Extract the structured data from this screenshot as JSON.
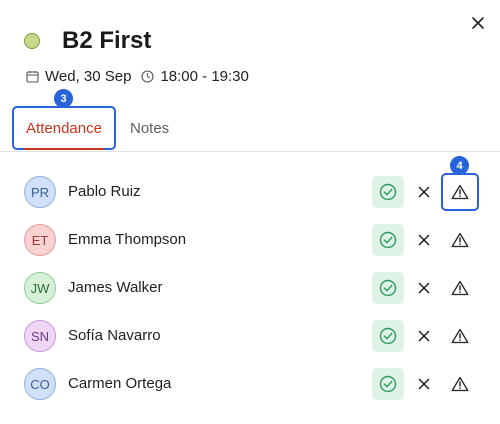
{
  "modal": {
    "title": "B2 First",
    "status_color": "#c6d98a",
    "date": "Wed, 30 Sep",
    "time": "18:00 - 19:30"
  },
  "tabs": [
    {
      "label": "Attendance",
      "active": true
    },
    {
      "label": "Notes",
      "active": false
    }
  ],
  "annotations": {
    "tab_badge": "3",
    "action_badge": "4"
  },
  "students": [
    {
      "initials": "PR",
      "name": "Pablo Ruiz",
      "avatar_bg": "#cfe0f7",
      "avatar_border": "#8fb1e4",
      "avatar_text": "#3d5f93"
    },
    {
      "initials": "ET",
      "name": "Emma Thompson",
      "avatar_bg": "#f8d3d1",
      "avatar_border": "#e59a95",
      "avatar_text": "#9a3d38"
    },
    {
      "initials": "JW",
      "name": "James Walker",
      "avatar_bg": "#d7f0d8",
      "avatar_border": "#8fcf94",
      "avatar_text": "#2f6b36"
    },
    {
      "initials": "SN",
      "name": "Sofía Navarro",
      "avatar_bg": "#efd6f5",
      "avatar_border": "#c993d9",
      "avatar_text": "#6c3a7e"
    },
    {
      "initials": "CO",
      "name": "Carmen Ortega",
      "avatar_bg": "#cfe0f7",
      "avatar_border": "#8fb1e4",
      "avatar_text": "#3d5f93"
    }
  ],
  "icons": {
    "close": "close-icon",
    "calendar": "calendar-icon",
    "clock": "clock-icon",
    "present": "check-circle-icon",
    "absent": "x-icon",
    "late": "warning-triangle-icon"
  },
  "colors": {
    "accent": "#2763d9",
    "active_tab": "#c7341a",
    "present_bg": "#dff2e6",
    "present_icon": "#2f9e62"
  }
}
